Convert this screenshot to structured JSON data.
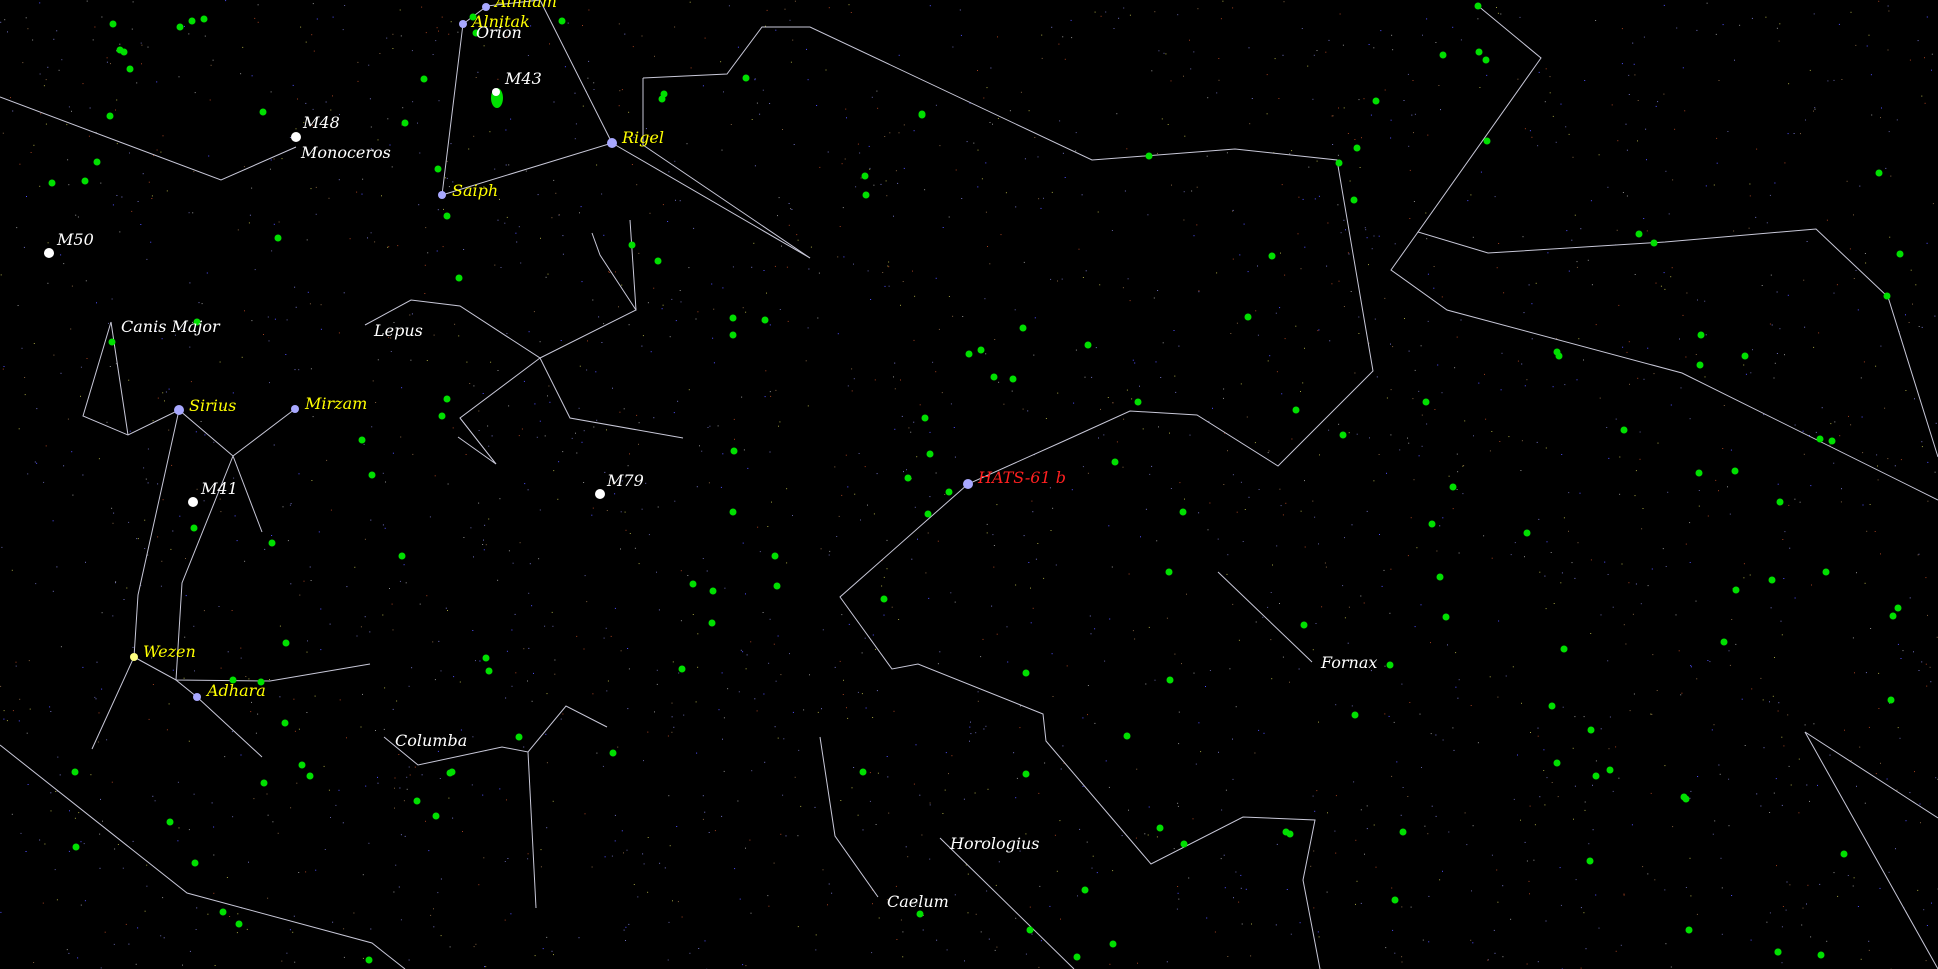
{
  "colors": {
    "background": "#000000",
    "constellation_line": "#c8c8d8",
    "star_label": "#ffff00",
    "constellation_label": "#ffffff",
    "messier_label": "#ffffff",
    "target_label": "#ff2020",
    "green_marker": "#00e000",
    "bright_star": "#a8a8ff"
  },
  "labels": {
    "alnilam": "Alnilam",
    "alnitak": "Alnitak",
    "orion": "Orion",
    "m43": "M43",
    "rigel": "Rigel",
    "saiph": "Saiph",
    "m48": "M48",
    "monoceros": "Monoceros",
    "m50": "M50",
    "canis_major": "Canis Major",
    "lepus": "Lepus",
    "sirius": "Sirius",
    "mirzam": "Mirzam",
    "m41": "M41",
    "m79": "M79",
    "hats61b": "HATS-61 b",
    "wezen": "Wezen",
    "adhara": "Adhara",
    "columba": "Columba",
    "fornax": "Fornax",
    "horologius": "Horologius",
    "caelum": "Caelum"
  }
}
